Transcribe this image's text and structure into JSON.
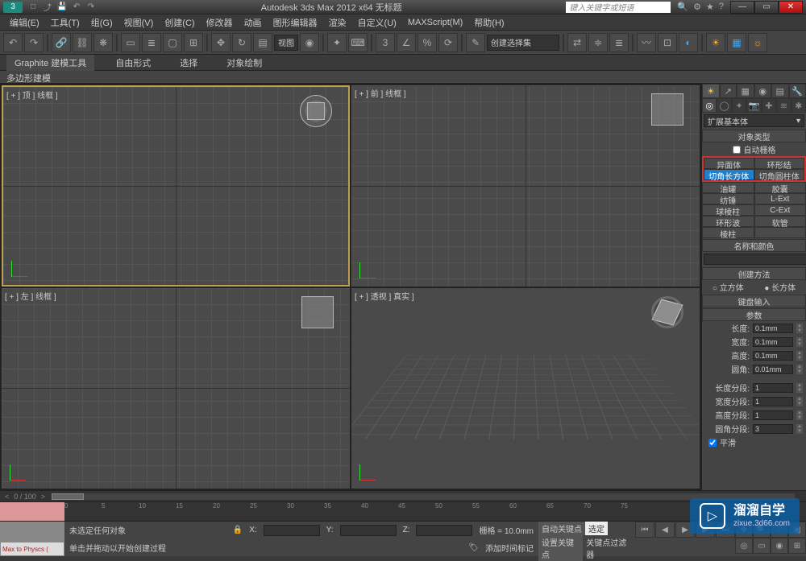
{
  "titlebar": {
    "title": "Autodesk 3ds Max  2012 x64      无标题",
    "search_placeholder": "键入关键字或短语"
  },
  "menubar": [
    "编辑(E)",
    "工具(T)",
    "组(G)",
    "视图(V)",
    "创建(C)",
    "修改器",
    "动画",
    "图形编辑器",
    "渲染",
    "自定义(U)",
    "MAXScript(M)",
    "帮助(H)"
  ],
  "toolbar_mid": {
    "view_label": "视图",
    "selset_label": "创建选择集"
  },
  "graphite": {
    "title": "Graphite 建模工具",
    "tabs": [
      "自由形式",
      "选择",
      "对象绘制"
    ]
  },
  "polymodel": "多边形建模",
  "viewports": {
    "top": "[ + ] 顶 ] 线框 ]",
    "front": "[ + ] 前 ] 线框 ]",
    "left": "[ + ] 左 ] 线框 ]",
    "persp": "[ + ] 透视 ] 真实 ]"
  },
  "cmdpanel": {
    "category": "扩展基本体",
    "object_type": "对象类型",
    "autogrid": "自动栅格",
    "buttons": [
      [
        "异面体",
        "环形结"
      ],
      [
        "切角长方体",
        "切角圆柱体"
      ],
      [
        "油罐",
        "胶囊"
      ],
      [
        "纺锤",
        "L-Ext"
      ],
      [
        "球棱柱",
        "C-Ext"
      ],
      [
        "环形波",
        "软管"
      ],
      [
        "棱柱",
        ""
      ]
    ],
    "name_color": "名称和颜色",
    "create_method": "创建方法",
    "cube": "立方体",
    "box": "长方体",
    "keyboard": "键盘输入",
    "params": "参数",
    "length": "长度:",
    "width": "宽度:",
    "height": "高度:",
    "fillet": "圆角:",
    "lsegs": "长度分段:",
    "wsegs": "宽度分段:",
    "hsegs": "高度分段:",
    "fsegs": "圆角分段:",
    "smooth": "平滑",
    "vals": {
      "l": "0.1mm",
      "w": "0.1mm",
      "h": "0.1mm",
      "f": "0.01mm",
      "ls": "1",
      "ws": "1",
      "hs": "1",
      "fs": "3"
    }
  },
  "timeslider": "0 / 100",
  "statusbar": {
    "maxscript": "Max to Physcs (",
    "none_selected": "未选定任何对象",
    "prompt": "单击并拖动以开始创建过程",
    "add_marker": "添加时间标记",
    "grid": "栅格 = 10.0mm",
    "autokey": "自动关键点",
    "selected": "选定",
    "setkey": "设置关键点",
    "keyfilter": "关键点过滤器"
  },
  "watermark": {
    "main": "溜溜自学",
    "sub": "zixue.3d66.com"
  }
}
